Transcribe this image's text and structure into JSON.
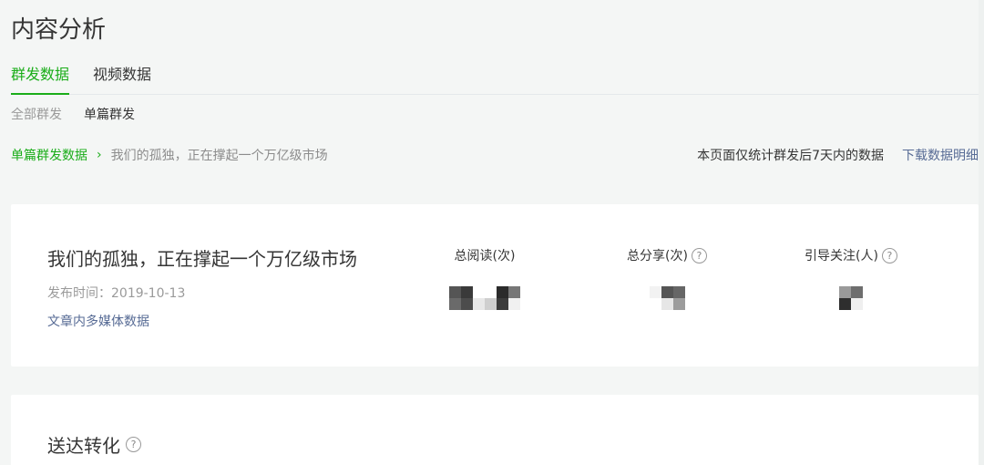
{
  "page": {
    "title": "内容分析"
  },
  "main_tabs": [
    {
      "label": "群发数据",
      "active": true
    },
    {
      "label": "视频数据",
      "active": false
    }
  ],
  "sub_tabs": [
    {
      "label": "全部群发",
      "active": false
    },
    {
      "label": "单篇群发",
      "active": true
    }
  ],
  "breadcrumb": {
    "root": "单篇群发数据",
    "separator": "›",
    "current": "我们的孤独，正在撑起一个万亿级市场"
  },
  "notice": "本页面仅统计群发后7天内的数据",
  "download_label": "下载数据明细",
  "article": {
    "title": "我们的孤独，正在撑起一个万亿级市场",
    "publish_time": "发布时间：2019-10-13",
    "media_link": "文章内多媒体数据"
  },
  "metrics": [
    {
      "label": "总阅读(次)",
      "help": false,
      "value_obscured": true
    },
    {
      "label": "总分享(次)",
      "help": true,
      "value_obscured": true
    },
    {
      "label": "引导关注(人)",
      "help": true,
      "value_obscured": true
    }
  ],
  "conversion": {
    "title": "送达转化"
  },
  "help_glyph": "?",
  "colors": {
    "accent": "#1aad19",
    "link": "#576b95",
    "muted": "#9a9a9a",
    "background": "#f4f6f5"
  }
}
